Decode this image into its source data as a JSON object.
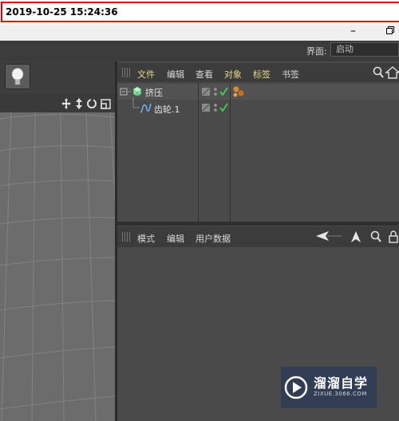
{
  "banner": {
    "timestamp": "2019-10-25 15:24:36"
  },
  "window": {
    "minimize_label": "–"
  },
  "ui_bar": {
    "layout_label": "界面:",
    "layout_value": "启动"
  },
  "object_manager": {
    "menu": [
      "文件",
      "编辑",
      "查看",
      "对象",
      "标签",
      "书签"
    ],
    "objects": [
      {
        "name": "挤压",
        "icon": "extrude-icon"
      },
      {
        "name": "齿轮.1",
        "icon": "spline-gear-icon"
      }
    ]
  },
  "attribute_manager": {
    "menu": [
      "模式",
      "编辑",
      "用户数据"
    ]
  },
  "watermark": {
    "title": "溜溜自学",
    "subtitle": "ZIXUE.3066.COM"
  },
  "colors": {
    "accent_menu": "#e8d88a",
    "check": "#3fd25a",
    "banner_border": "#e00000"
  }
}
